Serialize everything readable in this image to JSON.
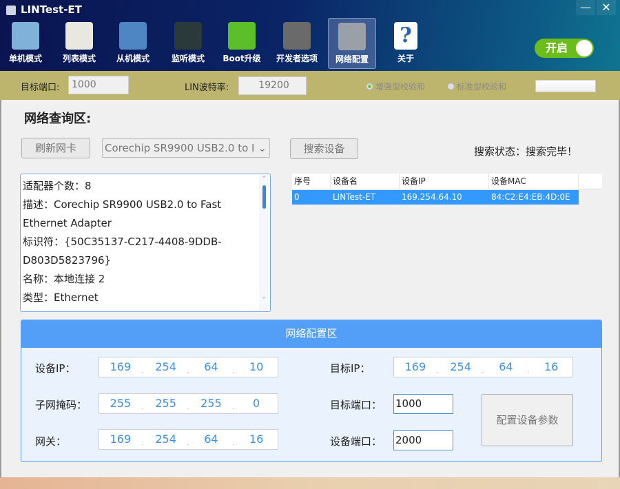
{
  "window": {
    "title": "LINTest-ET",
    "minimize": "—",
    "close": "✕"
  },
  "toolbar": {
    "items": [
      {
        "label": "单机模式",
        "icon": "monitor-icon",
        "color": "#7fb1d9"
      },
      {
        "label": "列表模式",
        "icon": "notepad-icon",
        "color": "#e8e8e0"
      },
      {
        "label": "从机模式",
        "icon": "arrow-window-icon",
        "color": "#4e86c4"
      },
      {
        "label": "监听模式",
        "icon": "pulse-monitor-icon",
        "color": "#2a3a3a"
      },
      {
        "label": "Boot升级",
        "icon": "download-drive-icon",
        "color": "#5cbf2a"
      },
      {
        "label": "开发者选项",
        "icon": "gear-icon",
        "color": "#6a6a6a"
      },
      {
        "label": "网络配置",
        "icon": "tools-icon",
        "color": "#9aa0a8"
      },
      {
        "label": "关于",
        "icon": "help-icon",
        "color": "#ffffff"
      }
    ],
    "active": "网络配置",
    "toggle_label": "开启",
    "toggle_on": true
  },
  "settings": {
    "target_port_label": "目标端口:",
    "target_port": "1000",
    "baud_label": "LIN波特率:",
    "baud": "19200",
    "checksum_enhanced": "增强型校验和",
    "checksum_standard": "标准型校验和",
    "selected": "增强型校验和"
  },
  "query": {
    "title": "网络查询区:",
    "refresh_label": "刷新网卡",
    "adapter": "Corechip SR9900 USB2.0 to I",
    "search_label": "搜索设备",
    "status": "搜索状态：搜索完毕！",
    "info_lines": [
      "适配器个数：8",
      "描述：Corechip SR9900 USB2.0 to Fast",
      "Ethernet Adapter",
      "标识符：{50C35137-C217-4408-9DDB-",
      "D803D5823796}",
      "名称：本地连接 2",
      "类型：Ethernet"
    ],
    "table": {
      "headers": [
        "序号",
        "设备名",
        "设备IP",
        "设备MAC"
      ],
      "rows": [
        [
          "0",
          "LINTest-ET",
          "169.254.64.10",
          "84:C2:E4:EB:4D:0E"
        ]
      ]
    }
  },
  "config": {
    "title": "网络配置区",
    "device_ip_label": "设备IP：",
    "device_ip": [
      "169",
      "254",
      "64",
      "10"
    ],
    "mask_label": "子网掩码：",
    "mask": [
      "255",
      "255",
      "255",
      "0"
    ],
    "gateway_label": "网关：",
    "gateway": [
      "169",
      "254",
      "64",
      "16"
    ],
    "target_ip_label": "目标IP：",
    "target_ip": [
      "169",
      "254",
      "64",
      "16"
    ],
    "target_port_label": "目标端口：",
    "target_port": "1000",
    "device_port_label": "设备端口：",
    "device_port": "2000",
    "apply_label": "配置设备参数"
  }
}
